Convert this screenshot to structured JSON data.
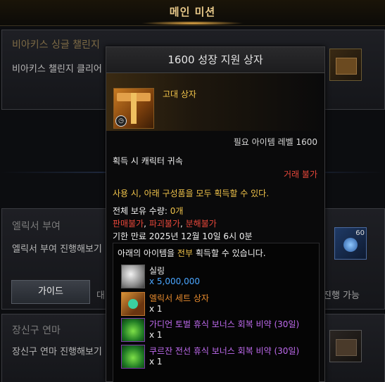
{
  "header": {
    "title": "메인 미션"
  },
  "missions": [
    {
      "title": "비아키스 싱글 챌린지",
      "desc": "비아키스 챌린지 클리어"
    },
    {
      "title": "엘릭서 부여",
      "desc": "엘릭서 부여 진행해보기",
      "right_text": "진행 가능",
      "guide_label": "가이드",
      "side_char": "대",
      "badge": "60"
    },
    {
      "title": "장신구 연마",
      "desc": "장신구 연마 진행해보기"
    }
  ],
  "tooltip": {
    "title": "1600 성장 지원 상자",
    "item_grade": "고대 상자",
    "required_level_label": "필요 아이템 레벨 1600",
    "bind": "획득 시 캐릭터 귀속",
    "trade": "거래 불가",
    "use_desc": "사용 시, 아래 구성품을 모두 획득할 수 있다.",
    "owned_label": "전체 보유 수량: ",
    "owned_value": "0개",
    "flag_sell": "판매불가",
    "flag_sep1": ", ",
    "flag_destroy": "파괴불가",
    "flag_sep2": ", ",
    "flag_disassemble": "분해불가",
    "expiry": "기한 만료 2025년 12월 10일 6시 0분",
    "contents_pre": "아래의 아이템을 ",
    "contents_highlight": "전부",
    "contents_post": " 획득할 수 있습니다.",
    "items": [
      {
        "name": "실링",
        "qty": "x 5,000,000",
        "icon": "silver-coin-icon"
      },
      {
        "name": "엘릭서 세트 상자",
        "qty": "x 1",
        "icon": "elixir-box-icon"
      },
      {
        "name": "가디언 토벌 휴식 보너스 회복 비약 (30일)",
        "qty": "x 1",
        "icon": "potion-icon"
      },
      {
        "name": "쿠르잔 전선 휴식 보너스 회복 비약 (30일)",
        "qty": "x 1",
        "icon": "potion-icon"
      }
    ]
  },
  "colors": {
    "gold": "#f0c34a",
    "red": "#e8473a",
    "orange": "#e88b2e",
    "purple": "#c06bf0",
    "blue_qty": "#4aa6ff"
  }
}
